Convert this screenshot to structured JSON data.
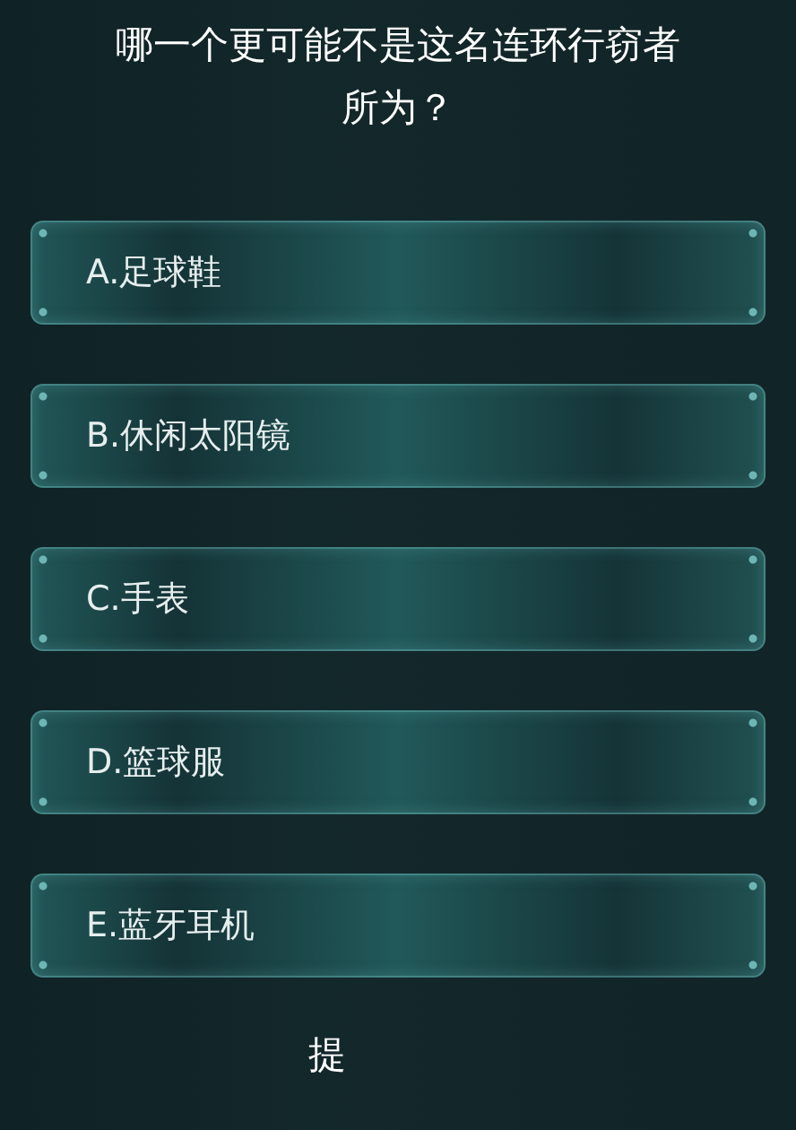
{
  "question": {
    "title_lines": [
      "哪一个更可能不是这名连环行窃者",
      "所为？"
    ],
    "options": [
      "A.足球鞋",
      "B.休闲太阳镜",
      "C.手表",
      "D.篮球服",
      "E.蓝牙耳机"
    ]
  },
  "submit_button": {
    "label": "提"
  }
}
